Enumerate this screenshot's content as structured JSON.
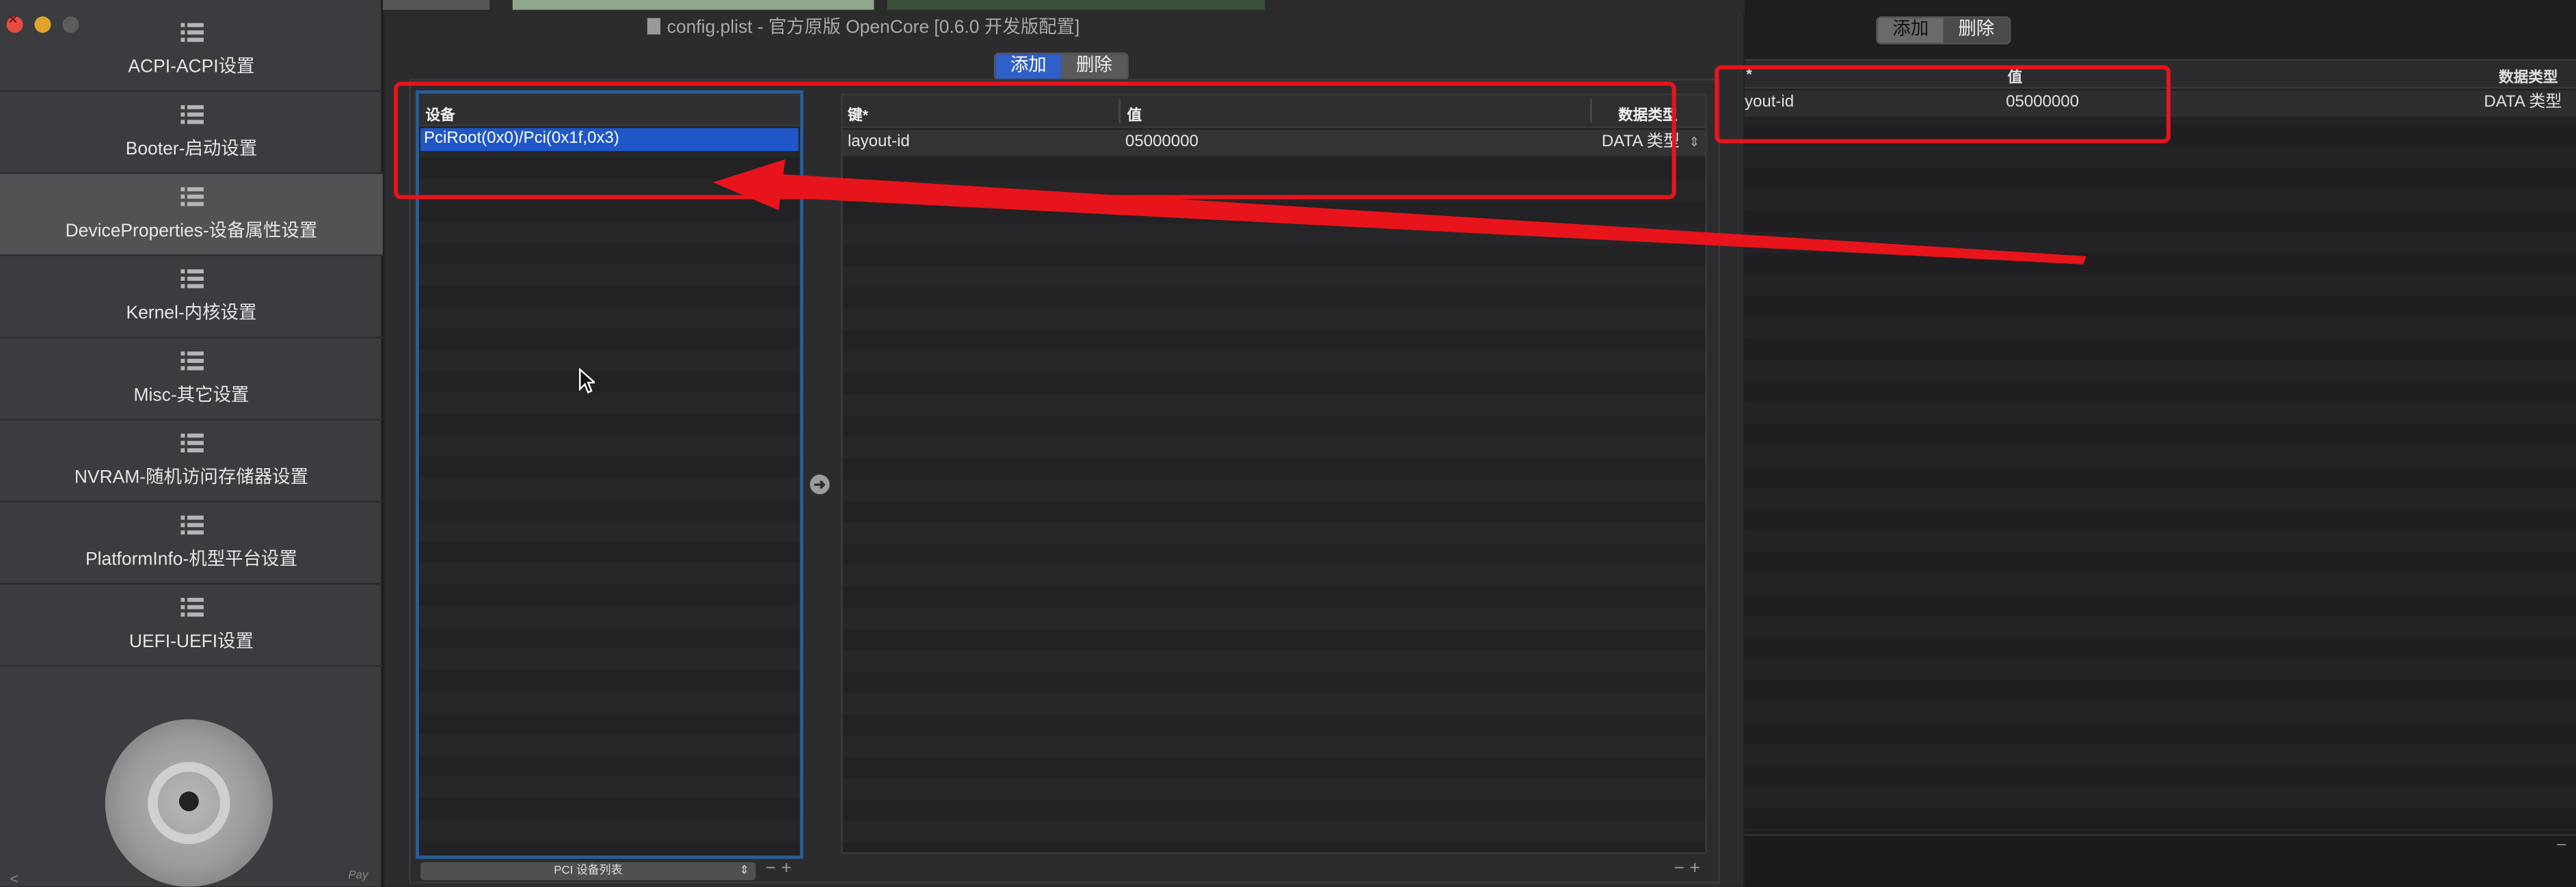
{
  "window": {
    "title": "config.plist - 官方原版 OpenCore [0.6.0 开发版配置]"
  },
  "sidebar": {
    "items": [
      {
        "label": "ACPI-ACPI设置",
        "icon": "list-icon"
      },
      {
        "label": "Booter-启动设置",
        "icon": "list-icon"
      },
      {
        "label": "DeviceProperties-设备属性设置",
        "icon": "list-icon",
        "selected": true
      },
      {
        "label": "Kernel-内核设置",
        "icon": "list-icon"
      },
      {
        "label": "Misc-其它设置",
        "icon": "list-icon"
      },
      {
        "label": "NVRAM-随机访问存储器设置",
        "icon": "list-icon"
      },
      {
        "label": "PlatformInfo-机型平台设置",
        "icon": "list-icon"
      },
      {
        "label": "UEFI-UEFI设置",
        "icon": "list-icon"
      }
    ],
    "pay_label": "Pay"
  },
  "toolbar": {
    "add_label": "添加",
    "delete_label": "删除"
  },
  "device_list": {
    "header": "设备",
    "rows": [
      "PciRoot(0x0)/Pci(0x1f,0x3)"
    ],
    "footer_select": "PCI 设备列表",
    "minus": "−",
    "plus": "+"
  },
  "kv_table": {
    "headers": {
      "key": "键*",
      "value": "值",
      "type": "数据类型"
    },
    "rows": [
      {
        "key": "layout-id",
        "value": "05000000",
        "type": "DATA 类型"
      }
    ],
    "minus": "−",
    "plus": "+"
  },
  "background_window": {
    "add_label": "添加",
    "delete_label": "删除",
    "headers": {
      "key": "*",
      "value": "值",
      "type": "数据类型"
    },
    "rows": [
      {
        "key": "yout-id",
        "value": "05000000",
        "type": "DATA 类型"
      }
    ],
    "minus": "−"
  },
  "colors": {
    "accent": "#1f57c8",
    "annotation": "#e8141b",
    "selection_border": "#2a5d97"
  }
}
